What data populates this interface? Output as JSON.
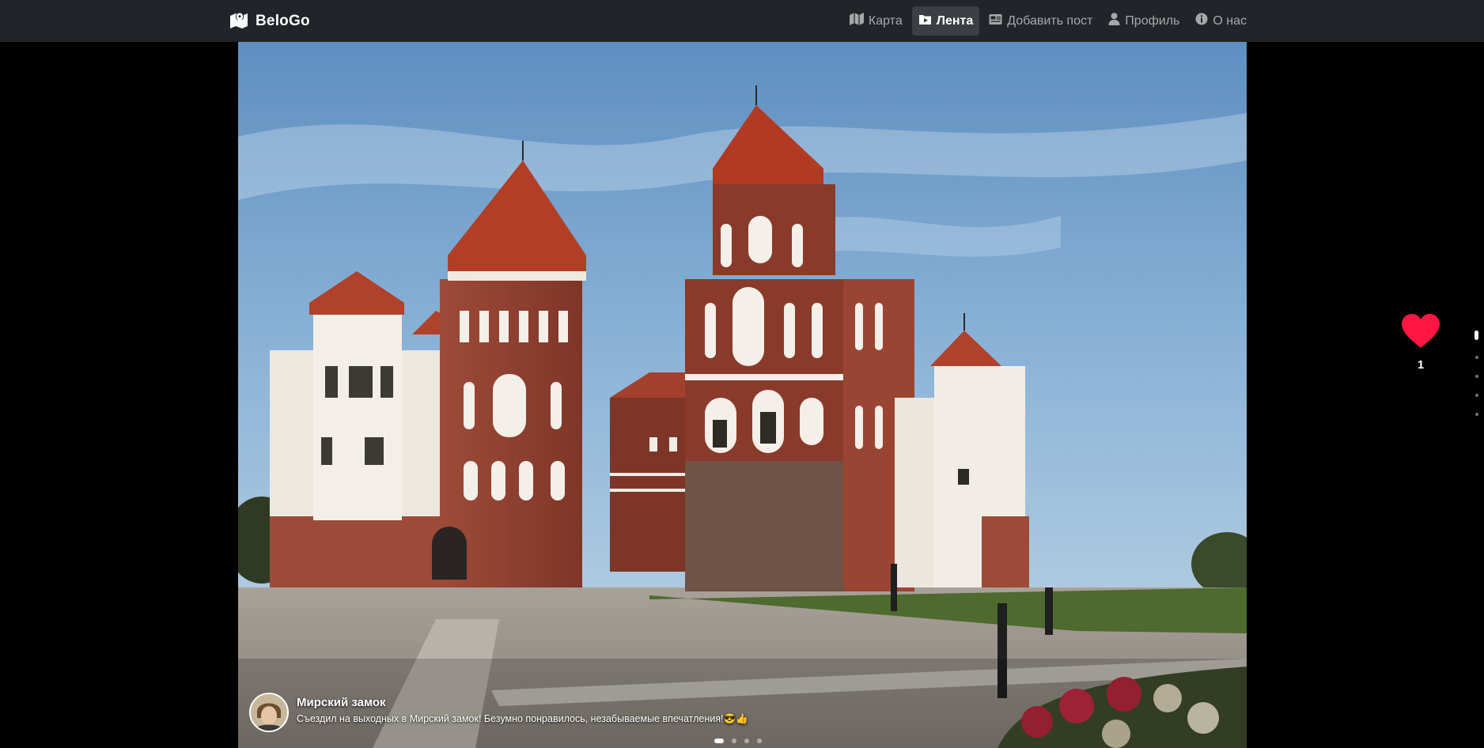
{
  "brand": {
    "name": "BeloGo",
    "icon": "map-marker-icon"
  },
  "nav": {
    "items": [
      {
        "label": "Карта",
        "icon": "map-icon",
        "active": false
      },
      {
        "label": "Лента",
        "icon": "feed-icon",
        "active": true
      },
      {
        "label": "Добавить пост",
        "icon": "add-post-icon",
        "active": false
      },
      {
        "label": "Профиль",
        "icon": "user-icon",
        "active": false
      },
      {
        "label": "О нас",
        "icon": "info-icon",
        "active": false
      }
    ]
  },
  "post": {
    "title": "Мирский замок",
    "description": "Съездил на выходных в Мирский замок! Безумно понравилось, незабываемые впечатления!😎👍",
    "likes": "1",
    "photo_count": 4,
    "active_photo": 1
  },
  "feed": {
    "post_count": 5,
    "active_post": 1
  },
  "colors": {
    "navbar": "#212529",
    "like": "#ff1744",
    "background": "#000000"
  }
}
